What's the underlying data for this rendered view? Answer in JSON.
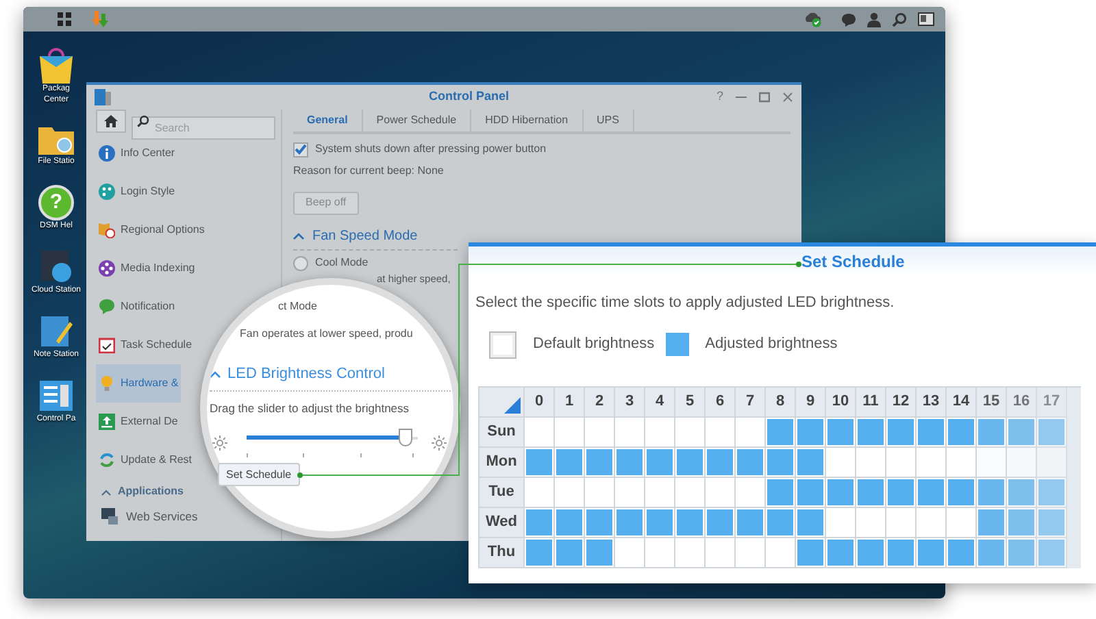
{
  "desktop_icons": [
    {
      "lines": [
        "Packag",
        "Center"
      ]
    },
    {
      "lines": [
        "File Statio"
      ]
    },
    {
      "lines": [
        "DSM Hel"
      ],
      "glyph": "?"
    },
    {
      "lines": [
        "Cloud Station"
      ]
    },
    {
      "lines": [
        "Note Station"
      ]
    },
    {
      "lines": [
        "Control Pa"
      ]
    }
  ],
  "window": {
    "title": "Control Panel",
    "help_glyph": "?",
    "search": {
      "placeholder": "Search"
    },
    "sidebar": {
      "items": [
        {
          "label": "Info Center",
          "selected": false
        },
        {
          "label": "Login Style",
          "selected": false
        },
        {
          "label": "Regional Options",
          "selected": false
        },
        {
          "label": "Media Indexing",
          "selected": false
        },
        {
          "label": "Notification",
          "selected": false
        },
        {
          "label": "Task Schedule",
          "selected": false
        },
        {
          "label": "Hardware &",
          "selected": true
        },
        {
          "label": "External De",
          "selected": false
        },
        {
          "label": "Update & Rest",
          "selected": false
        }
      ],
      "section": "Applications",
      "section_items": [
        {
          "label": "Web Services"
        }
      ]
    },
    "tabs": [
      {
        "label": "General",
        "selected": true
      },
      {
        "label": "Power Schedule",
        "selected": false
      },
      {
        "label": "HDD Hibernation",
        "selected": false
      },
      {
        "label": "UPS",
        "selected": false
      }
    ],
    "power_checkbox": {
      "label": "System shuts down after pressing power button",
      "checked": true
    },
    "beep_reason": "Reason for current beep: None",
    "beep_button": "Beep off",
    "fan_section": "Fan Speed Mode",
    "fan_options": [
      {
        "label": "Cool Mode",
        "selected": false
      }
    ],
    "fan_partial_text": "at higher speed,"
  },
  "magnifier": {
    "partial_heading": "ct Mode",
    "fan_description": "Fan operates at lower speed, produ",
    "section": "LED Brightness Control",
    "hint": "Drag the slider to adjust the brightness",
    "slider": {
      "level": 0.93
    },
    "button": "Set Schedule"
  },
  "schedule": {
    "title": "Set Schedule",
    "description": "Select the specific time slots to apply adjusted LED brightness.",
    "legend": [
      {
        "label": "Default brightness",
        "kind": "default"
      },
      {
        "label": "Adjusted brightness",
        "kind": "adjusted"
      }
    ],
    "hours": [
      "0",
      "1",
      "2",
      "3",
      "4",
      "5",
      "6",
      "7",
      "8",
      "9",
      "10",
      "11",
      "12",
      "13",
      "14",
      "15",
      "16",
      "17"
    ],
    "rows": [
      {
        "day": "Sun",
        "adjusted": [
          false,
          false,
          false,
          false,
          false,
          false,
          false,
          false,
          true,
          true,
          true,
          true,
          true,
          true,
          true,
          true,
          true,
          true
        ]
      },
      {
        "day": "Mon",
        "adjusted": [
          true,
          true,
          true,
          true,
          true,
          true,
          true,
          true,
          true,
          true,
          false,
          false,
          false,
          false,
          false,
          false,
          false,
          false
        ]
      },
      {
        "day": "Tue",
        "adjusted": [
          false,
          false,
          false,
          false,
          false,
          false,
          false,
          false,
          true,
          true,
          true,
          true,
          true,
          true,
          true,
          true,
          true,
          true
        ]
      },
      {
        "day": "Wed",
        "adjusted": [
          true,
          true,
          true,
          true,
          true,
          true,
          true,
          true,
          true,
          true,
          false,
          false,
          false,
          false,
          false,
          true,
          true,
          true
        ]
      },
      {
        "day": "Thu",
        "adjusted": [
          true,
          true,
          true,
          false,
          false,
          false,
          false,
          false,
          false,
          true,
          true,
          true,
          true,
          true,
          true,
          true,
          true,
          true
        ]
      }
    ]
  }
}
